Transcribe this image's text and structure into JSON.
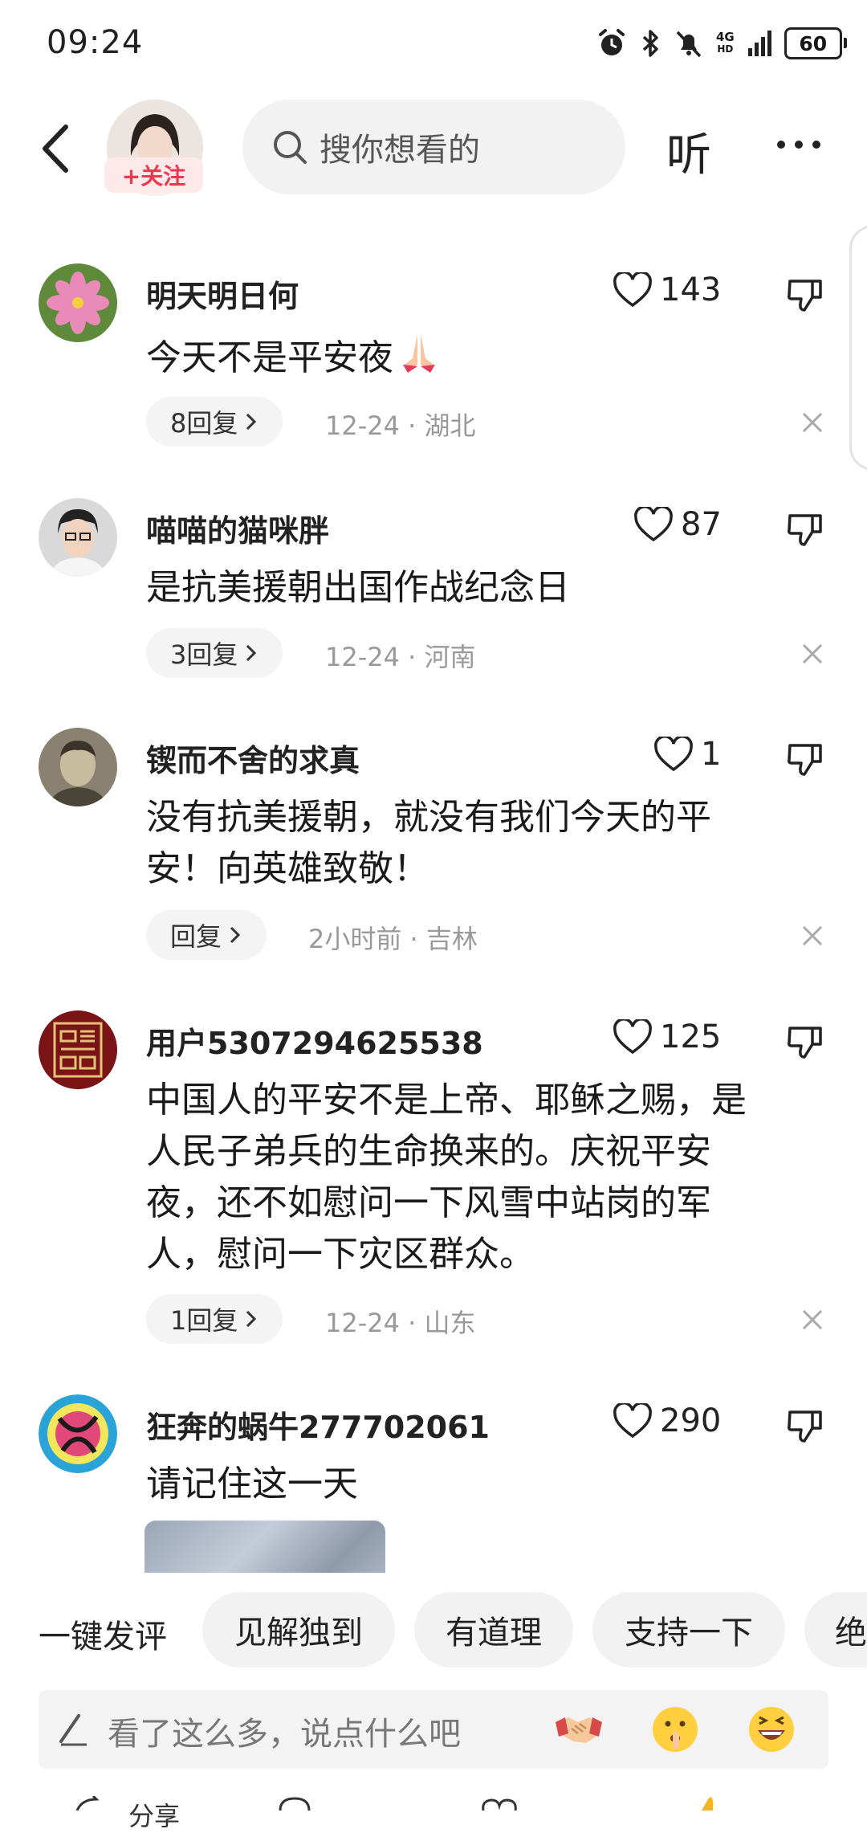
{
  "status_bar": {
    "time": "09:24",
    "network": "4G",
    "network_sub": "HD",
    "battery": "60"
  },
  "header": {
    "follow_label": "+关注",
    "search_placeholder": "搜你想看的",
    "listen_label": "听"
  },
  "comments": [
    {
      "name": "明天明日何",
      "text": "今天不是平安夜",
      "likes": "143",
      "replies": "8回复",
      "date": "12-24",
      "location": "湖北"
    },
    {
      "name": "喵喵的猫咪胖",
      "text": "是抗美援朝出国作战纪念日",
      "likes": "87",
      "replies": "3回复",
      "date": "12-24",
      "location": "河南"
    },
    {
      "name": "锲而不舍的求真",
      "text_lines": [
        "没有抗美援朝，就没有我们今天的平",
        "安！向英雄致敬！"
      ],
      "likes": "1",
      "replies": "回复",
      "date": "2小时前",
      "location": "吉林"
    },
    {
      "name": "用户5307294625538",
      "text_lines": [
        "中国人的平安不是上帝、耶稣之赐，是",
        "人民子弟兵的生命换来的。庆祝平安",
        "夜，还不如慰问一下风雪中站岗的军",
        "人，慰问一下灾区群众。"
      ],
      "likes": "125",
      "replies": "1回复",
      "date": "12-24",
      "location": "山东"
    },
    {
      "name": "狂奔的蜗牛277702061",
      "text": "请记住这一天",
      "likes": "290"
    }
  ],
  "quick_comments": {
    "label": "一键发评",
    "chips": [
      "见解独到",
      "有道理",
      "支持一下",
      "绝"
    ]
  },
  "input": {
    "placeholder": "看了这么多，说点什么吧"
  },
  "bottom_bar": {
    "share_label": "分享"
  },
  "colors": {
    "follow_text": "#ea3a4f",
    "follow_bg": "#fde8ea",
    "meta": "#999999"
  },
  "icons": [
    "back-arrow-icon",
    "search-icon",
    "more-icon",
    "heart-icon",
    "dislike-icon",
    "chevron-right-icon",
    "close-icon",
    "pencil-icon"
  ]
}
